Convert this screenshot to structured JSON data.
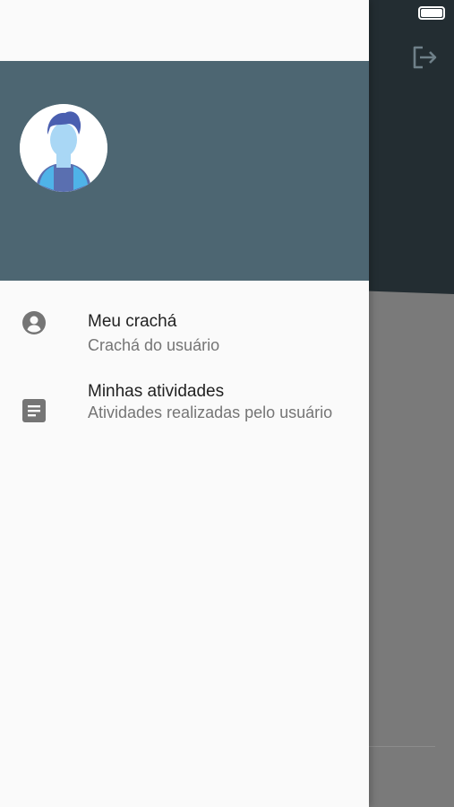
{
  "drawer": {
    "header_color": "#4d6672",
    "items": [
      {
        "icon": "account-circle-icon",
        "title": "Meu crachá",
        "subtitle": "Crachá do usuário"
      },
      {
        "icon": "document-icon",
        "title": "Minhas atividades",
        "subtitle": "Atividades realizadas pelo usuário"
      }
    ]
  },
  "background_app": {
    "header_color": "#232d32",
    "actions": [
      {
        "icon": "logout-icon"
      }
    ]
  },
  "status_bar": {
    "battery_icon": "battery-icon"
  }
}
